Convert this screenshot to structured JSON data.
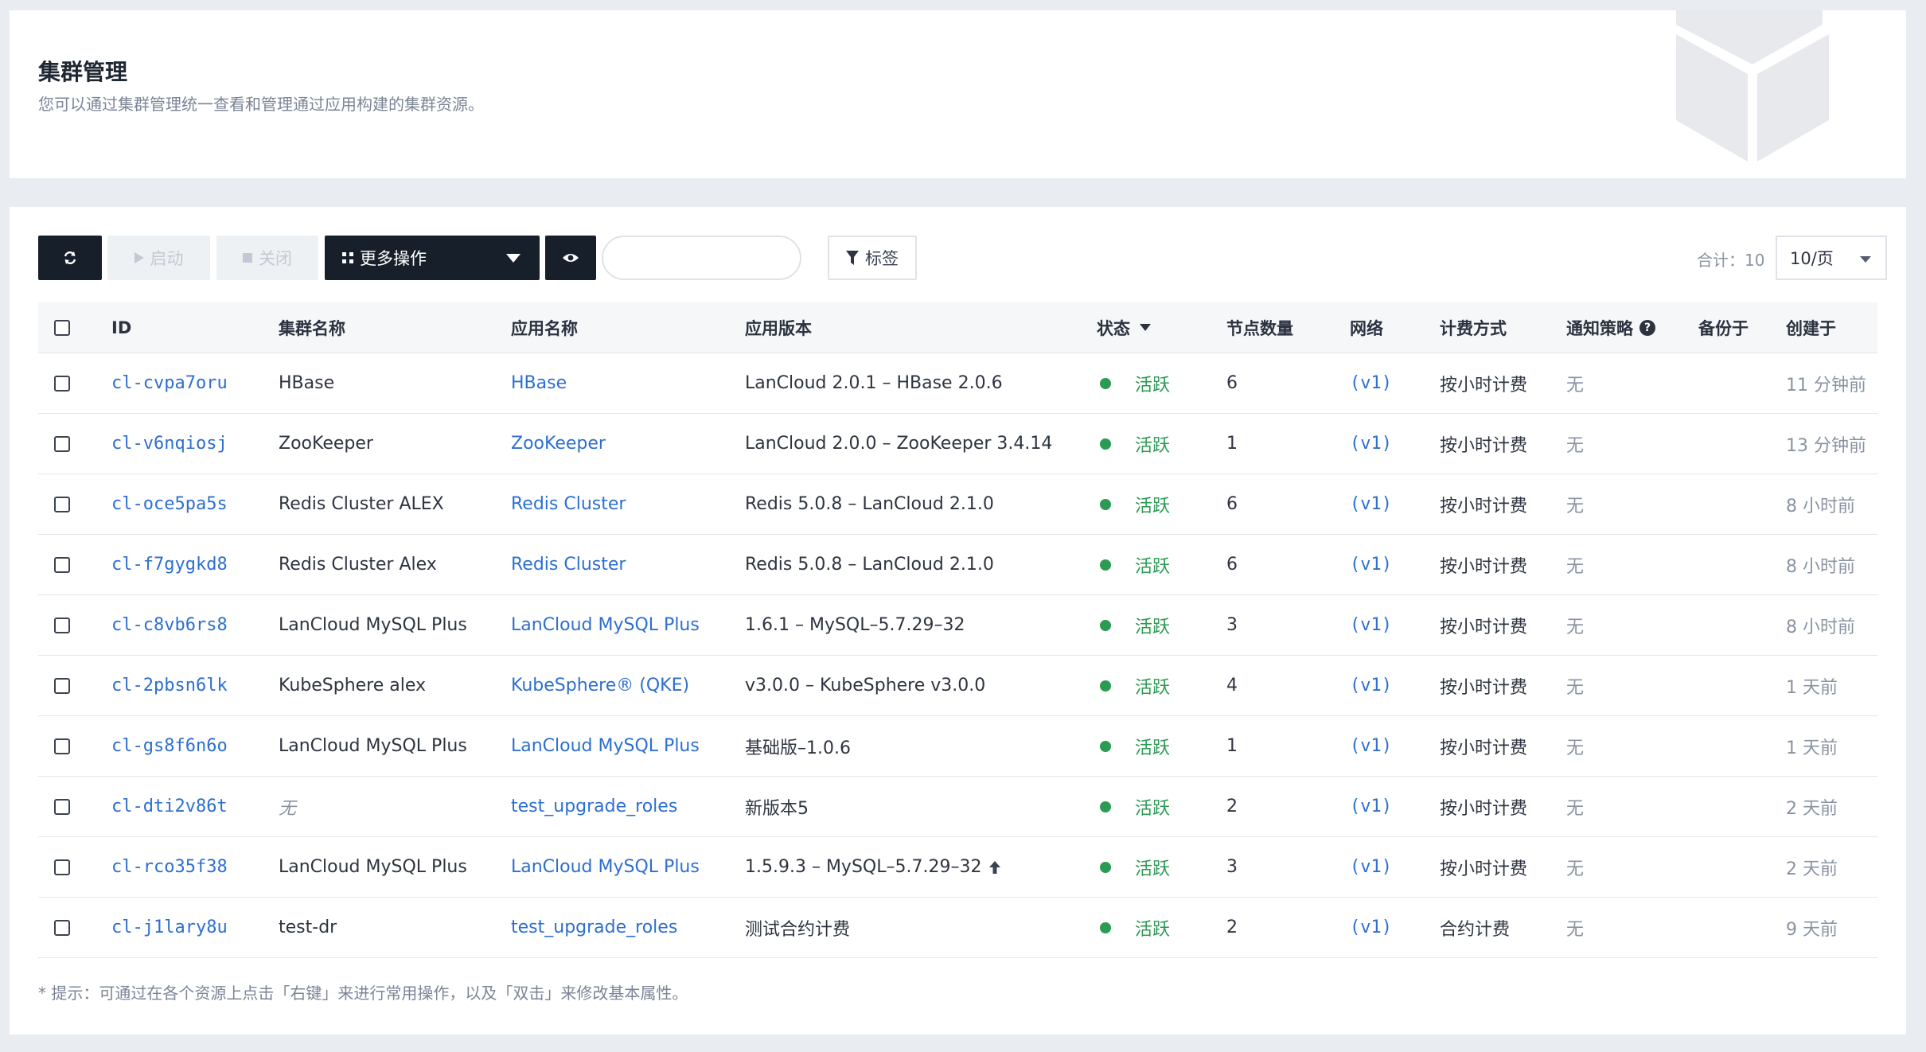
{
  "header": {
    "title": "集群管理",
    "description": "您可以通过集群管理统一查看和管理通过应用构建的集群资源。"
  },
  "toolbar": {
    "start_label": "启动",
    "stop_label": "关闭",
    "more_label": "更多操作",
    "tag_label": "标签",
    "search_placeholder": "",
    "total_label": "合计：10",
    "page_size": "10/页"
  },
  "table": {
    "headers": {
      "id": "ID",
      "name": "集群名称",
      "app": "应用名称",
      "version": "应用版本",
      "status": "状态",
      "nodes": "节点数量",
      "network": "网络",
      "billing": "计费方式",
      "notification": "通知策略",
      "backup": "备份于",
      "created": "创建于"
    },
    "rows": [
      {
        "id": "cl-cvpa7oru",
        "name": "HBase",
        "app": "HBase",
        "version": "LanCloud 2.0.1 – HBase 2.0.6",
        "status": "活跃",
        "nodes": "6",
        "network": "(v1)",
        "billing": "按小时计费",
        "notification": "无",
        "backup": "",
        "created": "11 分钟前"
      },
      {
        "id": "cl-v6nqiosj",
        "name": "ZooKeeper",
        "app": "ZooKeeper",
        "version": "LanCloud 2.0.0 – ZooKeeper 3.4.14",
        "status": "活跃",
        "nodes": "1",
        "network": "(v1)",
        "billing": "按小时计费",
        "notification": "无",
        "backup": "",
        "created": "13 分钟前"
      },
      {
        "id": "cl-oce5pa5s",
        "name": "Redis Cluster ALEX",
        "app": "Redis Cluster",
        "version": "Redis 5.0.8 – LanCloud 2.1.0",
        "status": "活跃",
        "nodes": "6",
        "network": "(v1)",
        "billing": "按小时计费",
        "notification": "无",
        "backup": "",
        "created": "8 小时前"
      },
      {
        "id": "cl-f7gygkd8",
        "name": "Redis Cluster Alex",
        "app": "Redis Cluster",
        "version": "Redis 5.0.8 – LanCloud 2.1.0",
        "status": "活跃",
        "nodes": "6",
        "network": "(v1)",
        "billing": "按小时计费",
        "notification": "无",
        "backup": "",
        "created": "8 小时前"
      },
      {
        "id": "cl-c8vb6rs8",
        "name": "LanCloud MySQL Plus",
        "app": "LanCloud MySQL Plus",
        "version": "1.6.1 – MySQL–5.7.29–32",
        "status": "活跃",
        "nodes": "3",
        "network": "(v1)",
        "billing": "按小时计费",
        "notification": "无",
        "backup": "",
        "created": "8 小时前"
      },
      {
        "id": "cl-2pbsn6lk",
        "name": "KubeSphere alex",
        "app": "KubeSphere® (QKE)",
        "version": "v3.0.0 – KubeSphere v3.0.0",
        "status": "活跃",
        "nodes": "4",
        "network": "(v1)",
        "billing": "按小时计费",
        "notification": "无",
        "backup": "",
        "created": "1 天前"
      },
      {
        "id": "cl-gs8f6n6o",
        "name": "LanCloud MySQL Plus",
        "app": "LanCloud MySQL Plus",
        "version": "基础版–1.0.6",
        "status": "活跃",
        "nodes": "1",
        "network": "(v1)",
        "billing": "按小时计费",
        "notification": "无",
        "backup": "",
        "created": "1 天前"
      },
      {
        "id": "cl-dti2v86t",
        "name": "无",
        "app": "test_upgrade_roles",
        "version": "新版本5",
        "status": "活跃",
        "nodes": "2",
        "network": "(v1)",
        "billing": "按小时计费",
        "notification": "无",
        "backup": "",
        "created": "2 天前"
      },
      {
        "id": "cl-rco35f38",
        "name": "LanCloud MySQL Plus",
        "app": "LanCloud MySQL Plus",
        "version": "1.5.9.3 – MySQL–5.7.29–32",
        "status": "活跃",
        "nodes": "3",
        "network": "(v1)",
        "billing": "按小时计费",
        "notification": "无",
        "backup": "",
        "created": "2 天前",
        "upgrade": true
      },
      {
        "id": "cl-j1lary8u",
        "name": "test-dr",
        "app": "test_upgrade_roles",
        "version": "测试合约计费",
        "status": "活跃",
        "nodes": "2",
        "network": "(v1)",
        "billing": "合约计费",
        "notification": "无",
        "backup": "",
        "created": "9 天前"
      }
    ]
  },
  "hint": "* 提示：可通过在各个资源上点击「右键」来进行常用操作，以及「双击」来修改基本属性。",
  "colors": {
    "link": "#2d6fd0",
    "active": "#2b9a52",
    "dark_button": "#171f2b"
  }
}
